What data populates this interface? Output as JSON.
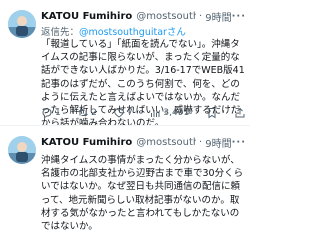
{
  "tweets": [
    {
      "name": "KATOU Fumihiro",
      "handle": "@mostsouthgui...",
      "time": "9時間",
      "reply_prefix": "返信先：",
      "reply_to": "@mostsouthguitarさん",
      "text": "「報道している」「紙面を読んでない」。沖縄タイムスの記事に限らないが、まったく定量的な話ができない人ばかりだ。3/16-17でWEB版41記事のはずだが、このうち何割で、何を、どのように伝えたと言えばよいではないか。なんだったら解析してみせればいい。威嚇するだけだから話が噛み合わないのだ。",
      "counts": {
        "reply": "1",
        "retweet": "2",
        "like": "7",
        "views": "3,491"
      }
    },
    {
      "name": "KATOU Fumihiro",
      "handle": "@mostsouthgui...",
      "time": "9時間",
      "text": "沖縄タイムスの事情がまったく分からないが、名護市の北部支社から辺野古まで車で30分くらいではないか。なぜ翌日も共同通信の配信に頼って、地元新聞らしい取材記事がないのか。取材する気がなかったと言われてもしかたないのではないか。",
      "counts": {
        "reply": "",
        "retweet": "",
        "like": "",
        "views": ""
      }
    }
  ]
}
